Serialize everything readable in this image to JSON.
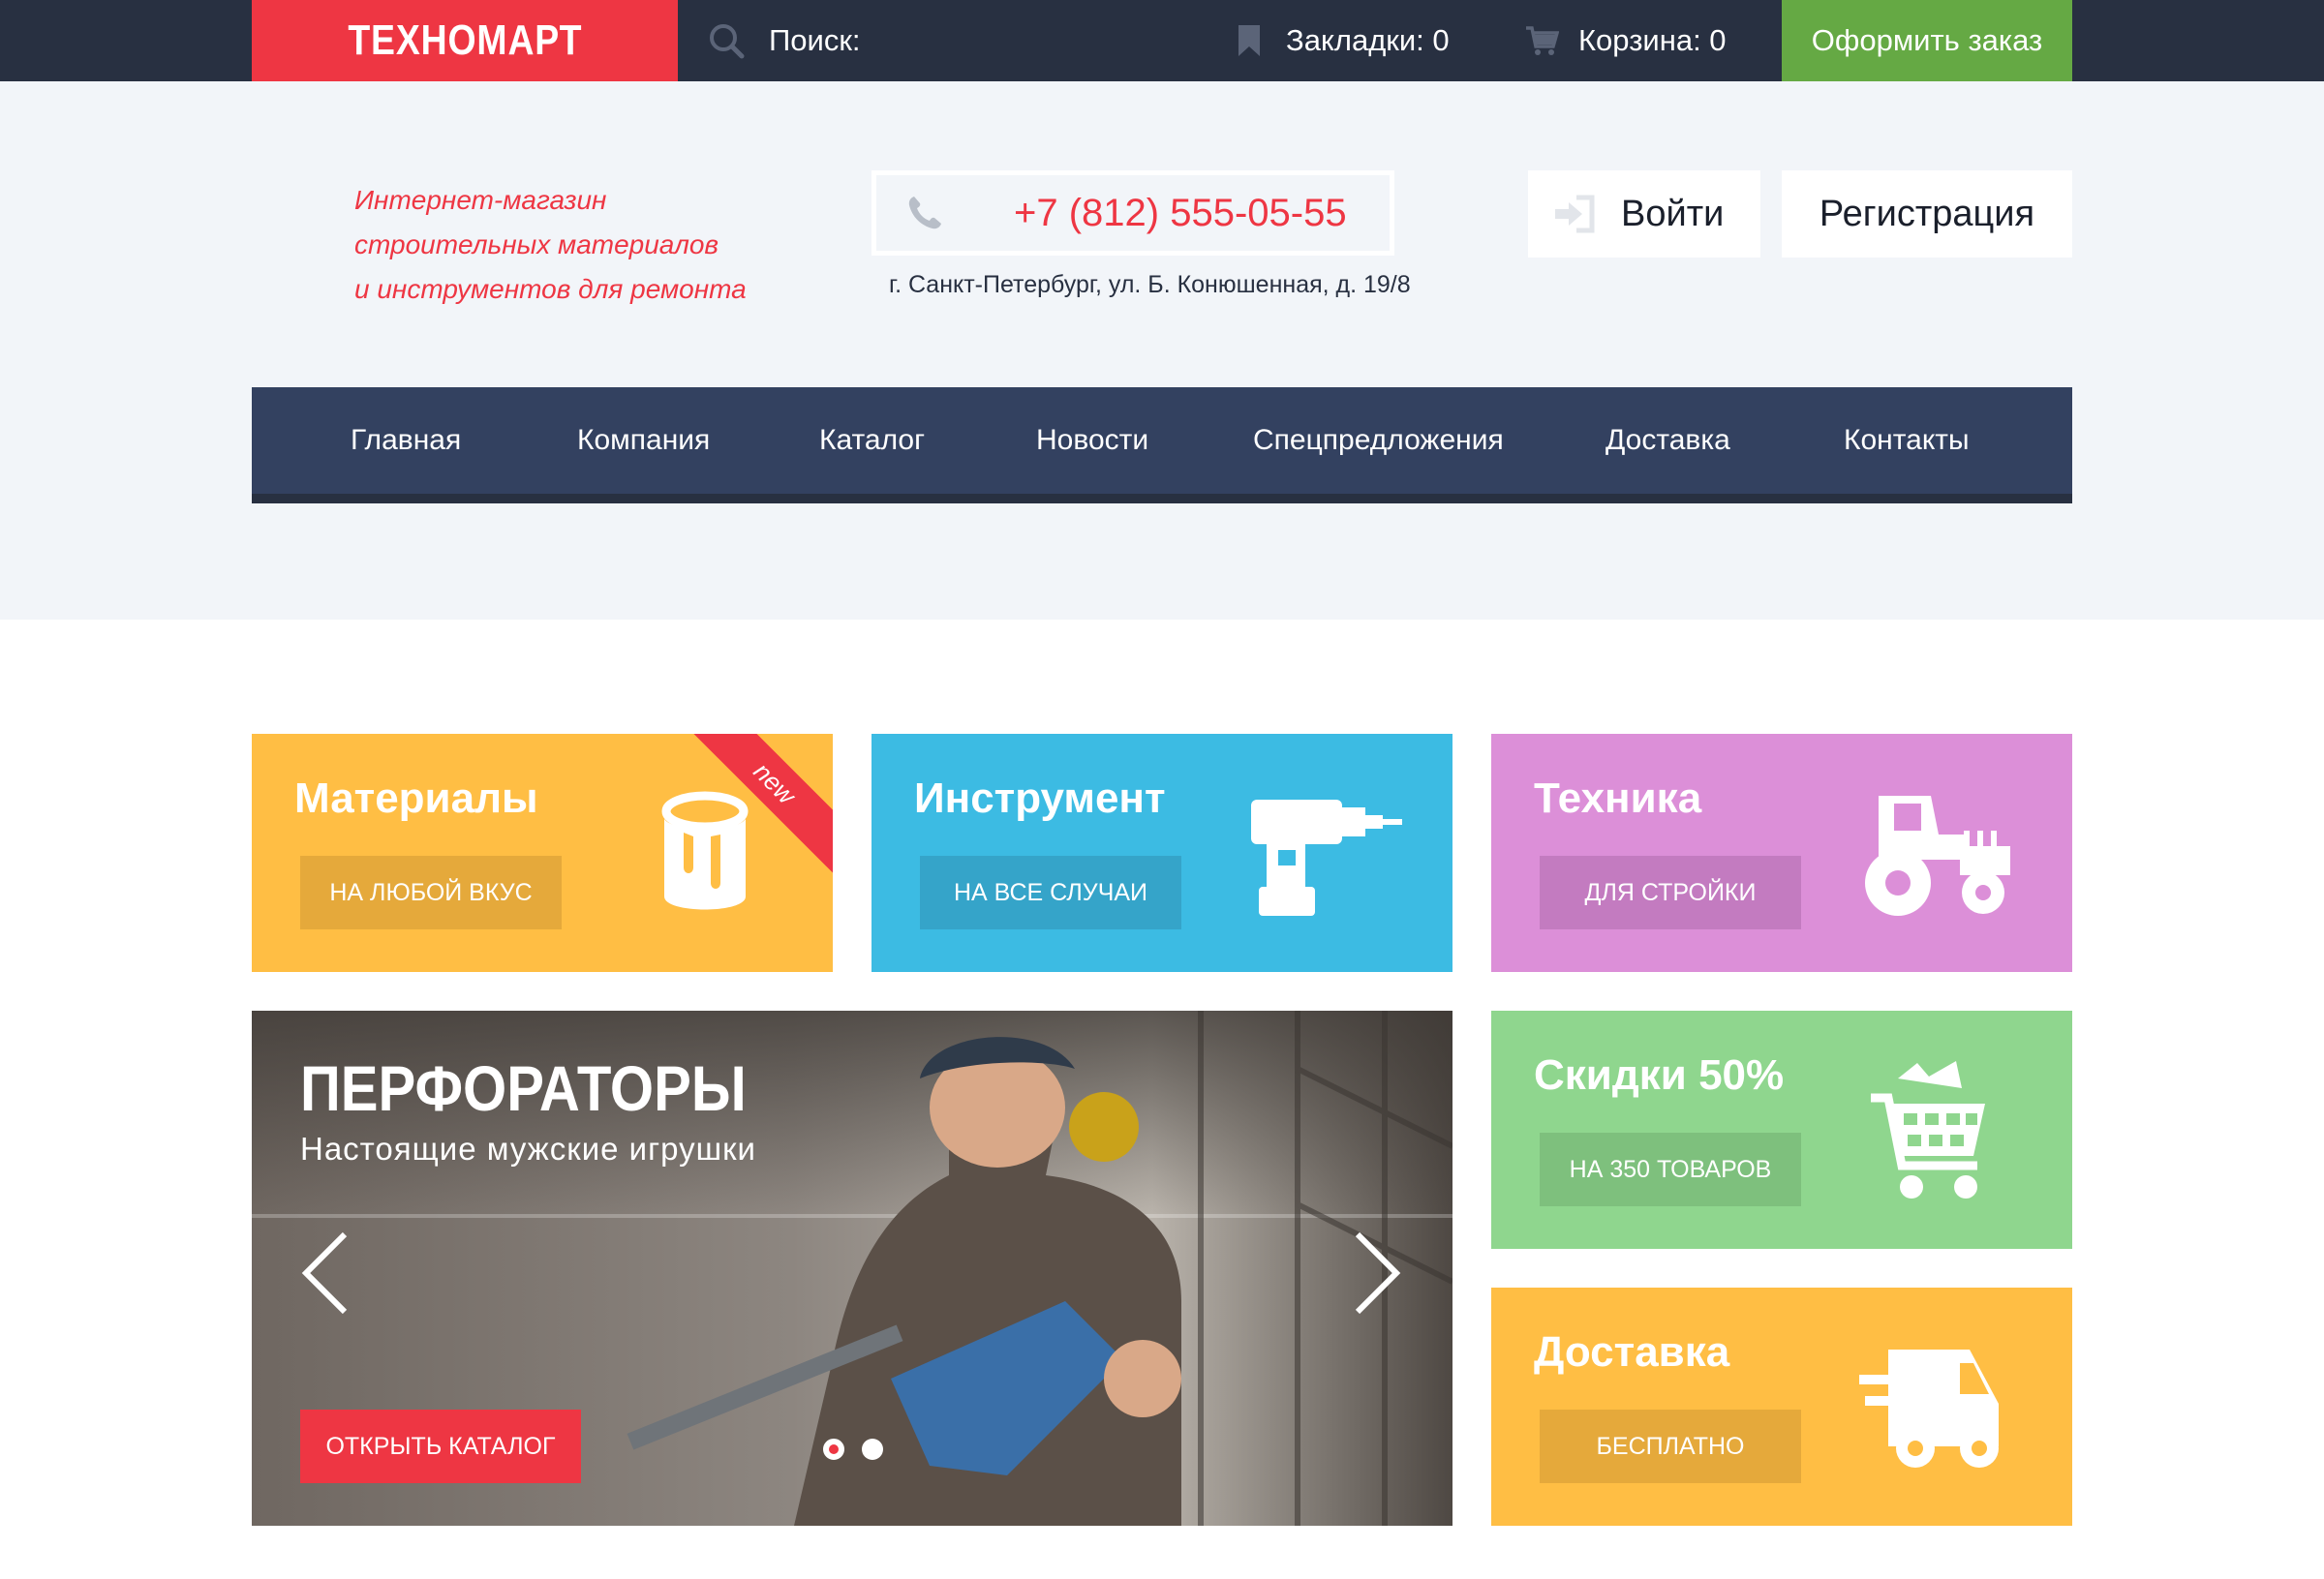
{
  "topbar": {
    "logo": "ТЕХНОМАРТ",
    "search_label": "Поиск:",
    "bookmarks": "Закладки: 0",
    "cart": "Корзина: 0",
    "order_button": "Оформить заказ",
    "icons": [
      "search-icon",
      "bookmark-icon",
      "cart-icon"
    ]
  },
  "header": {
    "tagline_lines": [
      "Интернет-магазин",
      "строительных материалов",
      "и инструментов для ремонта"
    ],
    "phone": "+7 (812) 555-05-55",
    "address": "г. Санкт-Петербург, ул. Б. Конюшенная, д. 19/8",
    "login": "Войти",
    "register": "Регистрация"
  },
  "nav": {
    "items": [
      "Главная",
      "Компания",
      "Каталог",
      "Новости",
      "Спецпредложения",
      "Доставка",
      "Контакты"
    ]
  },
  "tiles": {
    "materials": {
      "title": "Материалы",
      "button": "На любой вкус",
      "badge": "new",
      "icon": "paint-bucket-icon"
    },
    "tools": {
      "title": "Инструмент",
      "button": "На все случаи",
      "icon": "drill-icon"
    },
    "tech": {
      "title": "Техника",
      "button": "Для стройки",
      "icon": "tractor-icon"
    },
    "sale": {
      "title": "Скидки 50%",
      "button": "На 350 товаров",
      "icon": "shopping-cart-icon"
    },
    "delivery": {
      "title": "Доставка",
      "button": "Бесплатно",
      "icon": "delivery-truck-icon"
    }
  },
  "slider": {
    "title": "ПЕРФОРАТОРЫ",
    "subtitle": "Настоящие мужские игрушки",
    "button": "ОТКРЫТЬ КАТАЛОГ",
    "slide_count": 2,
    "active_slide": 1
  },
  "colors": {
    "dark": "#283041",
    "nav": "#334160",
    "accent_red": "#ee3643",
    "green": "#65a944",
    "yellow": "#ffbe44",
    "blue": "#3cbbe3",
    "pink": "#dc8fd8",
    "light_green": "#8fd68e",
    "header_bg": "#f2f5f9"
  }
}
